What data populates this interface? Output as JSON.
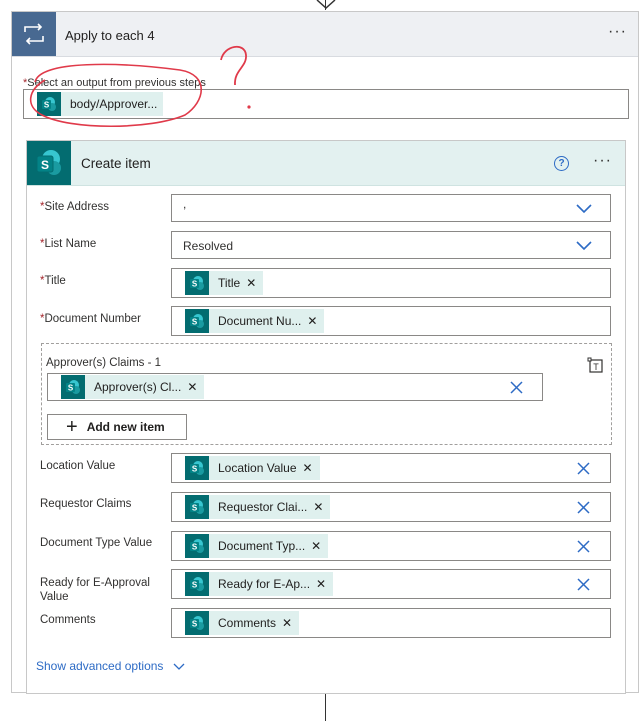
{
  "outer": {
    "title": "Apply to each 4",
    "more": "···",
    "select_label": "Select an output from previous steps",
    "required_mark": "*",
    "token": "body/Approver..."
  },
  "annotation": {
    "question_mark": "?"
  },
  "inner": {
    "title": "Create item",
    "help": "?",
    "more": "···",
    "fields": {
      "site_address": {
        "label": "Site Address",
        "value": ","
      },
      "list_name": {
        "label": "List Name",
        "value": "Resolved"
      },
      "title": {
        "label": "Title",
        "token": "Title"
      },
      "document_number": {
        "label": "Document Number",
        "token": "Document Nu..."
      },
      "approvers": {
        "label": "Approver(s) Claims - 1",
        "token": "Approver(s) Cl..."
      },
      "add_item": "Add new item",
      "location_value": {
        "label": "Location Value",
        "token": "Location Value"
      },
      "requestor_claims": {
        "label": "Requestor Claims",
        "token": "Requestor Clai..."
      },
      "document_type": {
        "label": "Document Type Value",
        "token": "Document Typ..."
      },
      "ready_for_approval": {
        "label": "Ready for E-Approval Value",
        "token": "Ready for E-Ap..."
      },
      "comments": {
        "label": "Comments",
        "token": "Comments"
      }
    },
    "advanced": "Show advanced options"
  },
  "icons": {
    "loop": "loop-icon",
    "sharepoint": "sharepoint-icon",
    "chevron": "chevron-down-icon",
    "clear": "clear-icon",
    "switch_mode": "switch-to-text-mode-icon",
    "add": "plus-icon"
  },
  "colors": {
    "loop_header": "#486991",
    "sharepoint": "#036c70",
    "link": "#2d6bc5",
    "required": "#a4262c",
    "annotation": "#e03a4a"
  }
}
